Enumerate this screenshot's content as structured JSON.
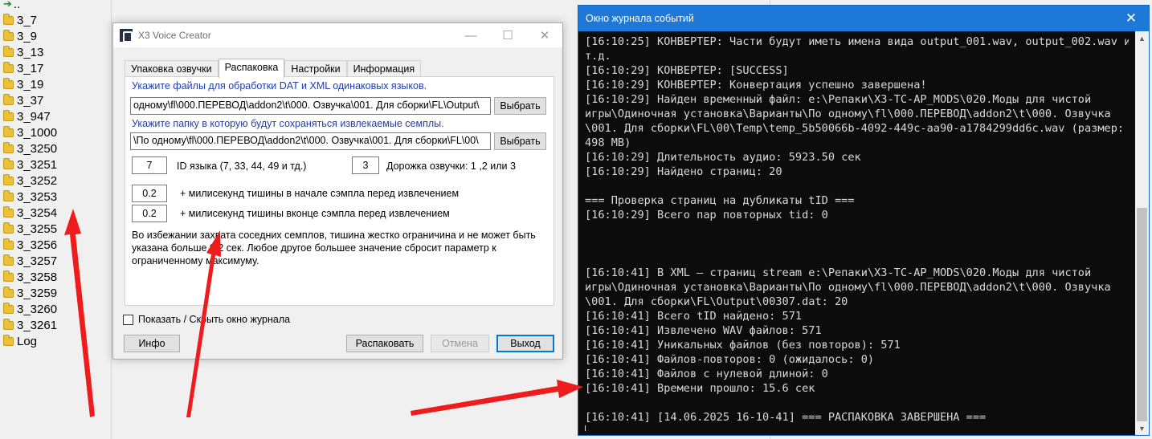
{
  "folder_list": {
    "up_label": "..",
    "items": [
      "3_7",
      "3_9",
      "3_13",
      "3_17",
      "3_19",
      "3_37",
      "3_947",
      "3_1000",
      "3_3250",
      "3_3251",
      "3_3252",
      "3_3253",
      "3_3254",
      "3_3255",
      "3_3256",
      "3_3257",
      "3_3258",
      "3_3259",
      "3_3260",
      "3_3261",
      "Log"
    ]
  },
  "main_window": {
    "title": "X3 Voice Creator",
    "minimize": "—",
    "maximize": "☐",
    "close": "✕",
    "tabs": [
      {
        "label": "Упаковка озвучки",
        "active": false
      },
      {
        "label": "Распаковка",
        "active": true
      },
      {
        "label": "Настройки",
        "active": false
      },
      {
        "label": "Информация",
        "active": false
      }
    ],
    "unpack": {
      "files_hint": "Укажите файлы для обработки DAT и XML одинаковых языков.",
      "files_path": "одному\\fl\\000.ПЕРЕВОД\\addon2\\t\\000. Озвучка\\001. Для сборки\\FL\\Output\\",
      "browse_label": "Выбрать",
      "folder_hint": "Укажите папку в которую будут сохраняться извлекаемые семплы.",
      "folder_path": "\\По одному\\fl\\000.ПЕРЕВОД\\addon2\\t\\000. Озвучка\\001. Для сборки\\FL\\00\\",
      "language_id": "7",
      "language_label": "ID языка (7, 33, 44, 49 и тд.)",
      "track_value": "3",
      "track_label": "Дорожка озвучки: 1 ,2 или 3",
      "silence_start": "0.2",
      "silence_start_label": "+ милисекунд тишины в начале сэмпла перед извлечением",
      "silence_end": "0.2",
      "silence_end_label": "+ милисекунд тишины вконце сэмпла перед извлечением",
      "note": "Во избежании захвата соседних семплов, тишина жестко ограничина и не может быть указана больше 0.2 сек. Любое другое большее значение сбросит параметр к ограниченному максимуму."
    },
    "show_log_label": "Показать / Скрыть окно журнала",
    "info_label": "Инфо",
    "unpack_label": "Распаковать",
    "cancel_label": "Отмена",
    "exit_label": "Выход"
  },
  "log_window": {
    "title": "Окно журнала событий",
    "close": "✕",
    "lines": [
      "[16:10:25] КОНВЕРТЕР: Части будут иметь имена вида output_001.wav, output_002.wav и",
      "т.д.",
      "[16:10:29] КОНВЕРТЕР: [SUCCESS]",
      "[16:10:29] КОНВЕРТЕР: Конвертация успешно завершена!",
      "[16:10:29]   Найден временный файл: e:\\Репаки\\X3-TC-AP_MODS\\020.Моды для чистой",
      "игры\\Одиночная установка\\Варианты\\По одному\\fl\\000.ПЕРЕВОД\\addon2\\t\\000. Озвучка",
      "\\001. Для сборки\\FL\\00\\Temp\\temp_5b50066b-4092-449c-aa90-a1784299dd6c.wav (размер:",
      "498 MB)",
      "[16:10:29]   Длительность аудио: 5923.50 сек",
      "[16:10:29]   Найдено страниц: 20",
      "",
      "=== Проверка страниц на дубликаты tID ===",
      "[16:10:29] Всего пар повторных tid: 0",
      "",
      "",
      "",
      "[16:10:41]   В XML — страниц stream e:\\Репаки\\X3-TC-AP_MODS\\020.Моды для чистой",
      "игры\\Одиночная установка\\Варианты\\По одному\\fl\\000.ПЕРЕВОД\\addon2\\t\\000. Озвучка",
      "\\001. Для сборки\\FL\\Output\\00307.dat: 20",
      "[16:10:41]   Всего tID найдено: 571",
      "[16:10:41]   Извлечено WAV файлов: 571",
      "[16:10:41]   Уникальных файлов (без повторов): 571",
      "[16:10:41]   Файлов-повторов: 0 (ожидалось: 0)",
      "[16:10:41]   Файлов с нулевой длиной: 0",
      "[16:10:41]   Времени прошло: 15.6 сек",
      "",
      "[16:10:41] [14.06.2025 16-10-41] === РАСПАКОВКА ЗАВЕРШЕНА ==="
    ]
  },
  "colors": {
    "hint_blue": "#1f3fb0",
    "log_titlebar": "#1e78d8",
    "log_background": "#0c0c0c",
    "log_text": "#d9d9d9",
    "folder_yellow": "#e7c23a",
    "arrow_red": "#ee1c1c"
  },
  "icons": {
    "up": "green-up-arrow-icon",
    "folder": "folder-icon",
    "app": "x3-logo-icon"
  }
}
